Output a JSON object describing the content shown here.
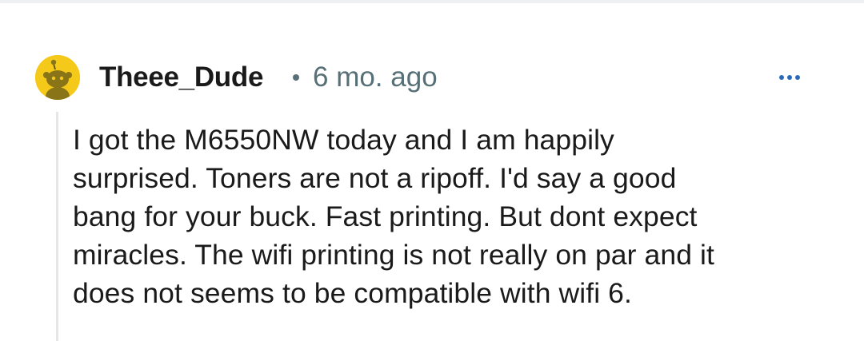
{
  "comment": {
    "author": "Theee_Dude",
    "separator": "•",
    "age": "6 mo. ago",
    "body": "I got the M6550NW today and I am happily\nsurprised. Toners are not a ripoff. I'd say a good\nbang for your buck. Fast printing. But dont expect\nmiracles. The wifi printing is not really on par and it\ndoes not seems to be compatible with wifi 6.",
    "avatar_icon": "snoo-avatar-icon",
    "more_icon": "more-options-icon"
  },
  "colors": {
    "avatar_bg": "#f5c91a",
    "text": "#1a1a1b",
    "meta": "#576f76",
    "accent": "#2a6ab8",
    "thread_line": "#e4e6e8"
  }
}
